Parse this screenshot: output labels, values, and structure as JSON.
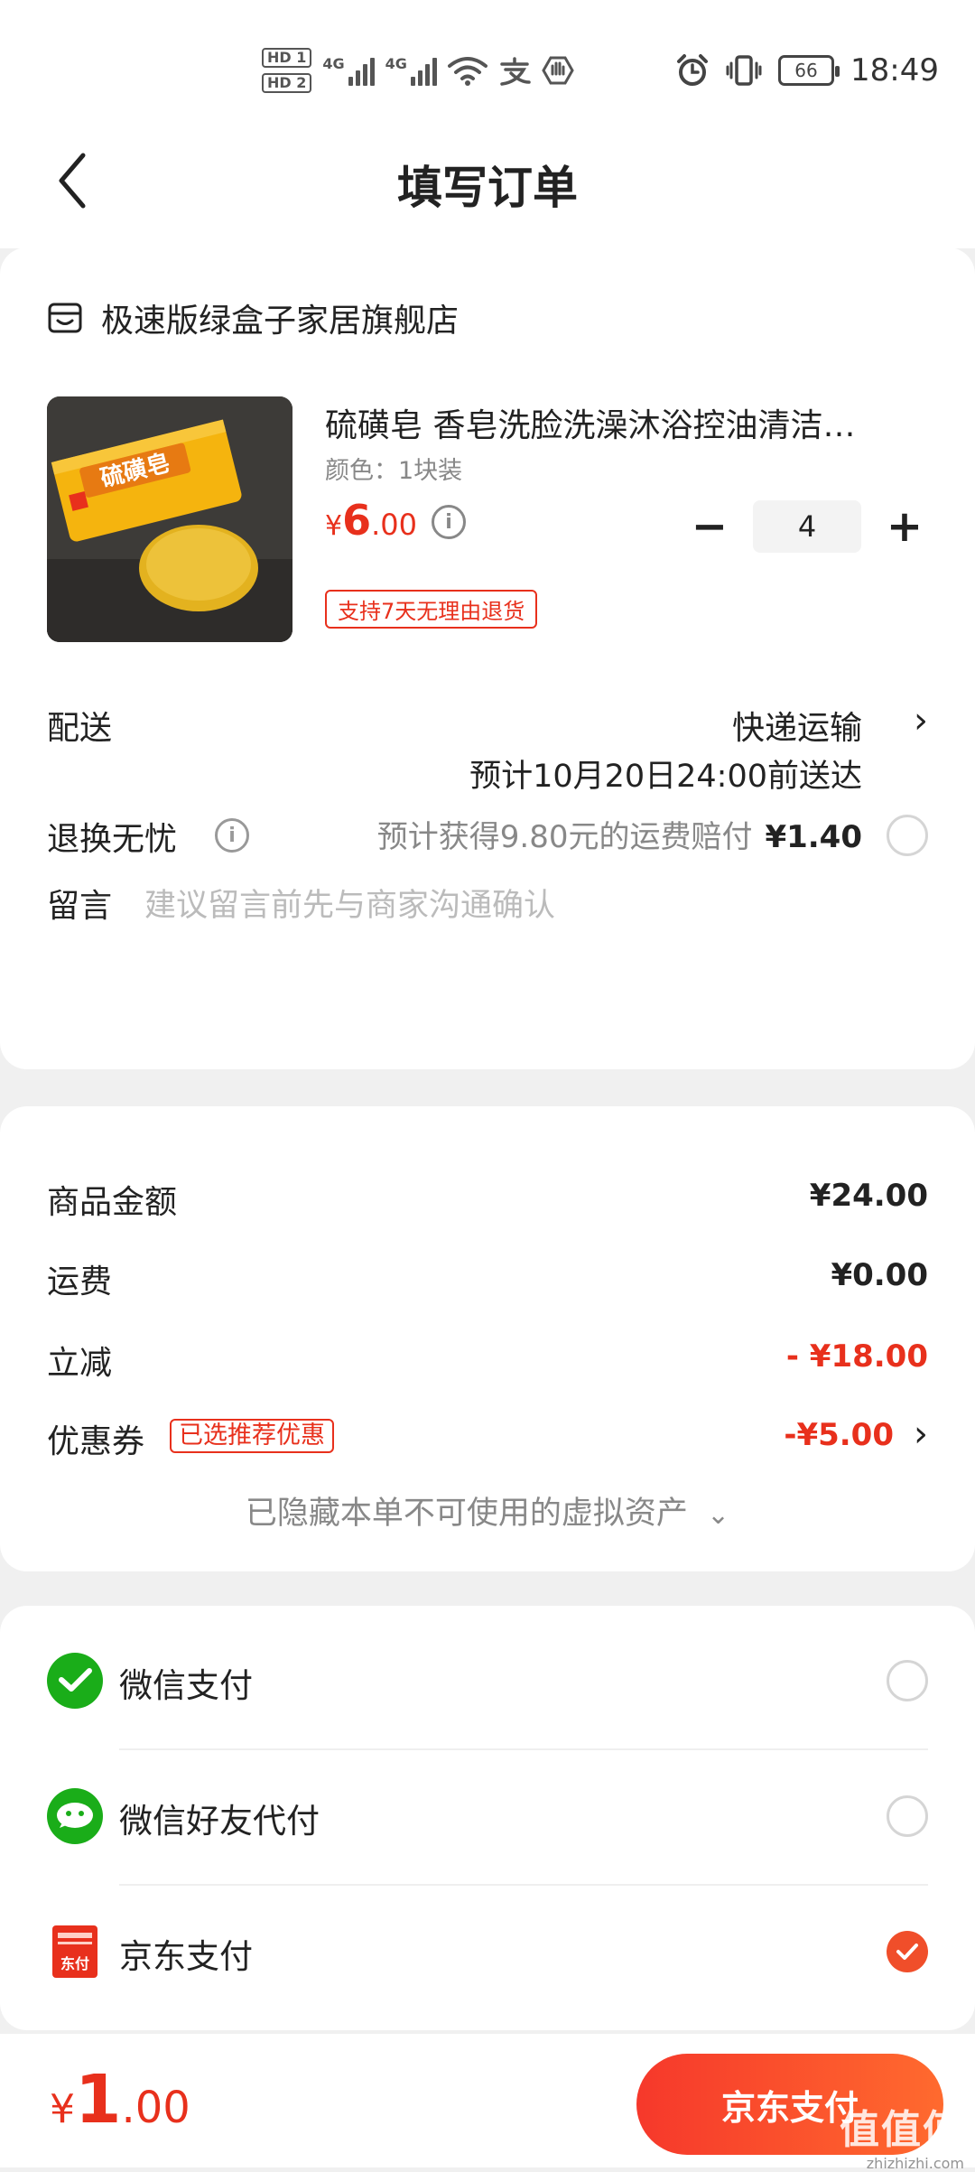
{
  "status_bar": {
    "hd1": "HD 1",
    "hd2": "HD 2",
    "net1": "4G",
    "net2": "4G",
    "battery": "66",
    "time": "18:49"
  },
  "header": {
    "title": "填写订单"
  },
  "order": {
    "store_name": "极速版绿盒子家居旗舰店",
    "product": {
      "title": "硫磺皂 香皂洗脸洗澡沐浴控油清洁…",
      "spec": "颜色：1块装",
      "price_currency": "¥",
      "price_int": "6",
      "price_dec": ".00",
      "quantity": "4",
      "minus": "−",
      "plus": "+",
      "return_tag": "支持7天无理由退货",
      "image_text": "硫磺皂"
    },
    "delivery": {
      "label": "配送",
      "mode": "快递运输",
      "eta": "预计10月20日24:00前送达"
    },
    "refund": {
      "label": "退换无忧",
      "info_icon": "i",
      "text": "预计获得9.80元的运费赔付",
      "price": "¥1.40"
    },
    "memo": {
      "label": "留言",
      "placeholder": "建议留言前先与商家沟通确认"
    }
  },
  "summary": {
    "goods_label": "商品金额",
    "goods_value": "¥24.00",
    "shipping_label": "运费",
    "shipping_value": "¥0.00",
    "discount_label": "立减",
    "discount_value": "- ¥18.00",
    "coupon_label": "优惠券",
    "coupon_tag": "已选推荐优惠",
    "coupon_value": "-¥5.00",
    "hidden_note": "已隐藏本单不可使用的虚拟资产",
    "hidden_chevron": "⌄"
  },
  "payment": {
    "methods": [
      {
        "label": "微信支付",
        "icon": "wechat-pay-icon",
        "selected": false
      },
      {
        "label": "微信好友代付",
        "icon": "wechat-friend-pay-icon",
        "selected": false
      },
      {
        "label": "京东支付",
        "icon": "jd-pay-icon",
        "selected": true
      }
    ],
    "jd_icon_text": "东付"
  },
  "bottom": {
    "total_currency": "¥",
    "total_int": "1",
    "total_dec": ".00",
    "pay_button": "京东支付"
  },
  "watermark": {
    "text": "值值值",
    "sub": "zhizhizhi.com"
  },
  "colors": {
    "accent": "#e8301c",
    "button_start": "#f6382b",
    "button_end": "#ff6a2e",
    "wechat_green": "#1aad19"
  }
}
